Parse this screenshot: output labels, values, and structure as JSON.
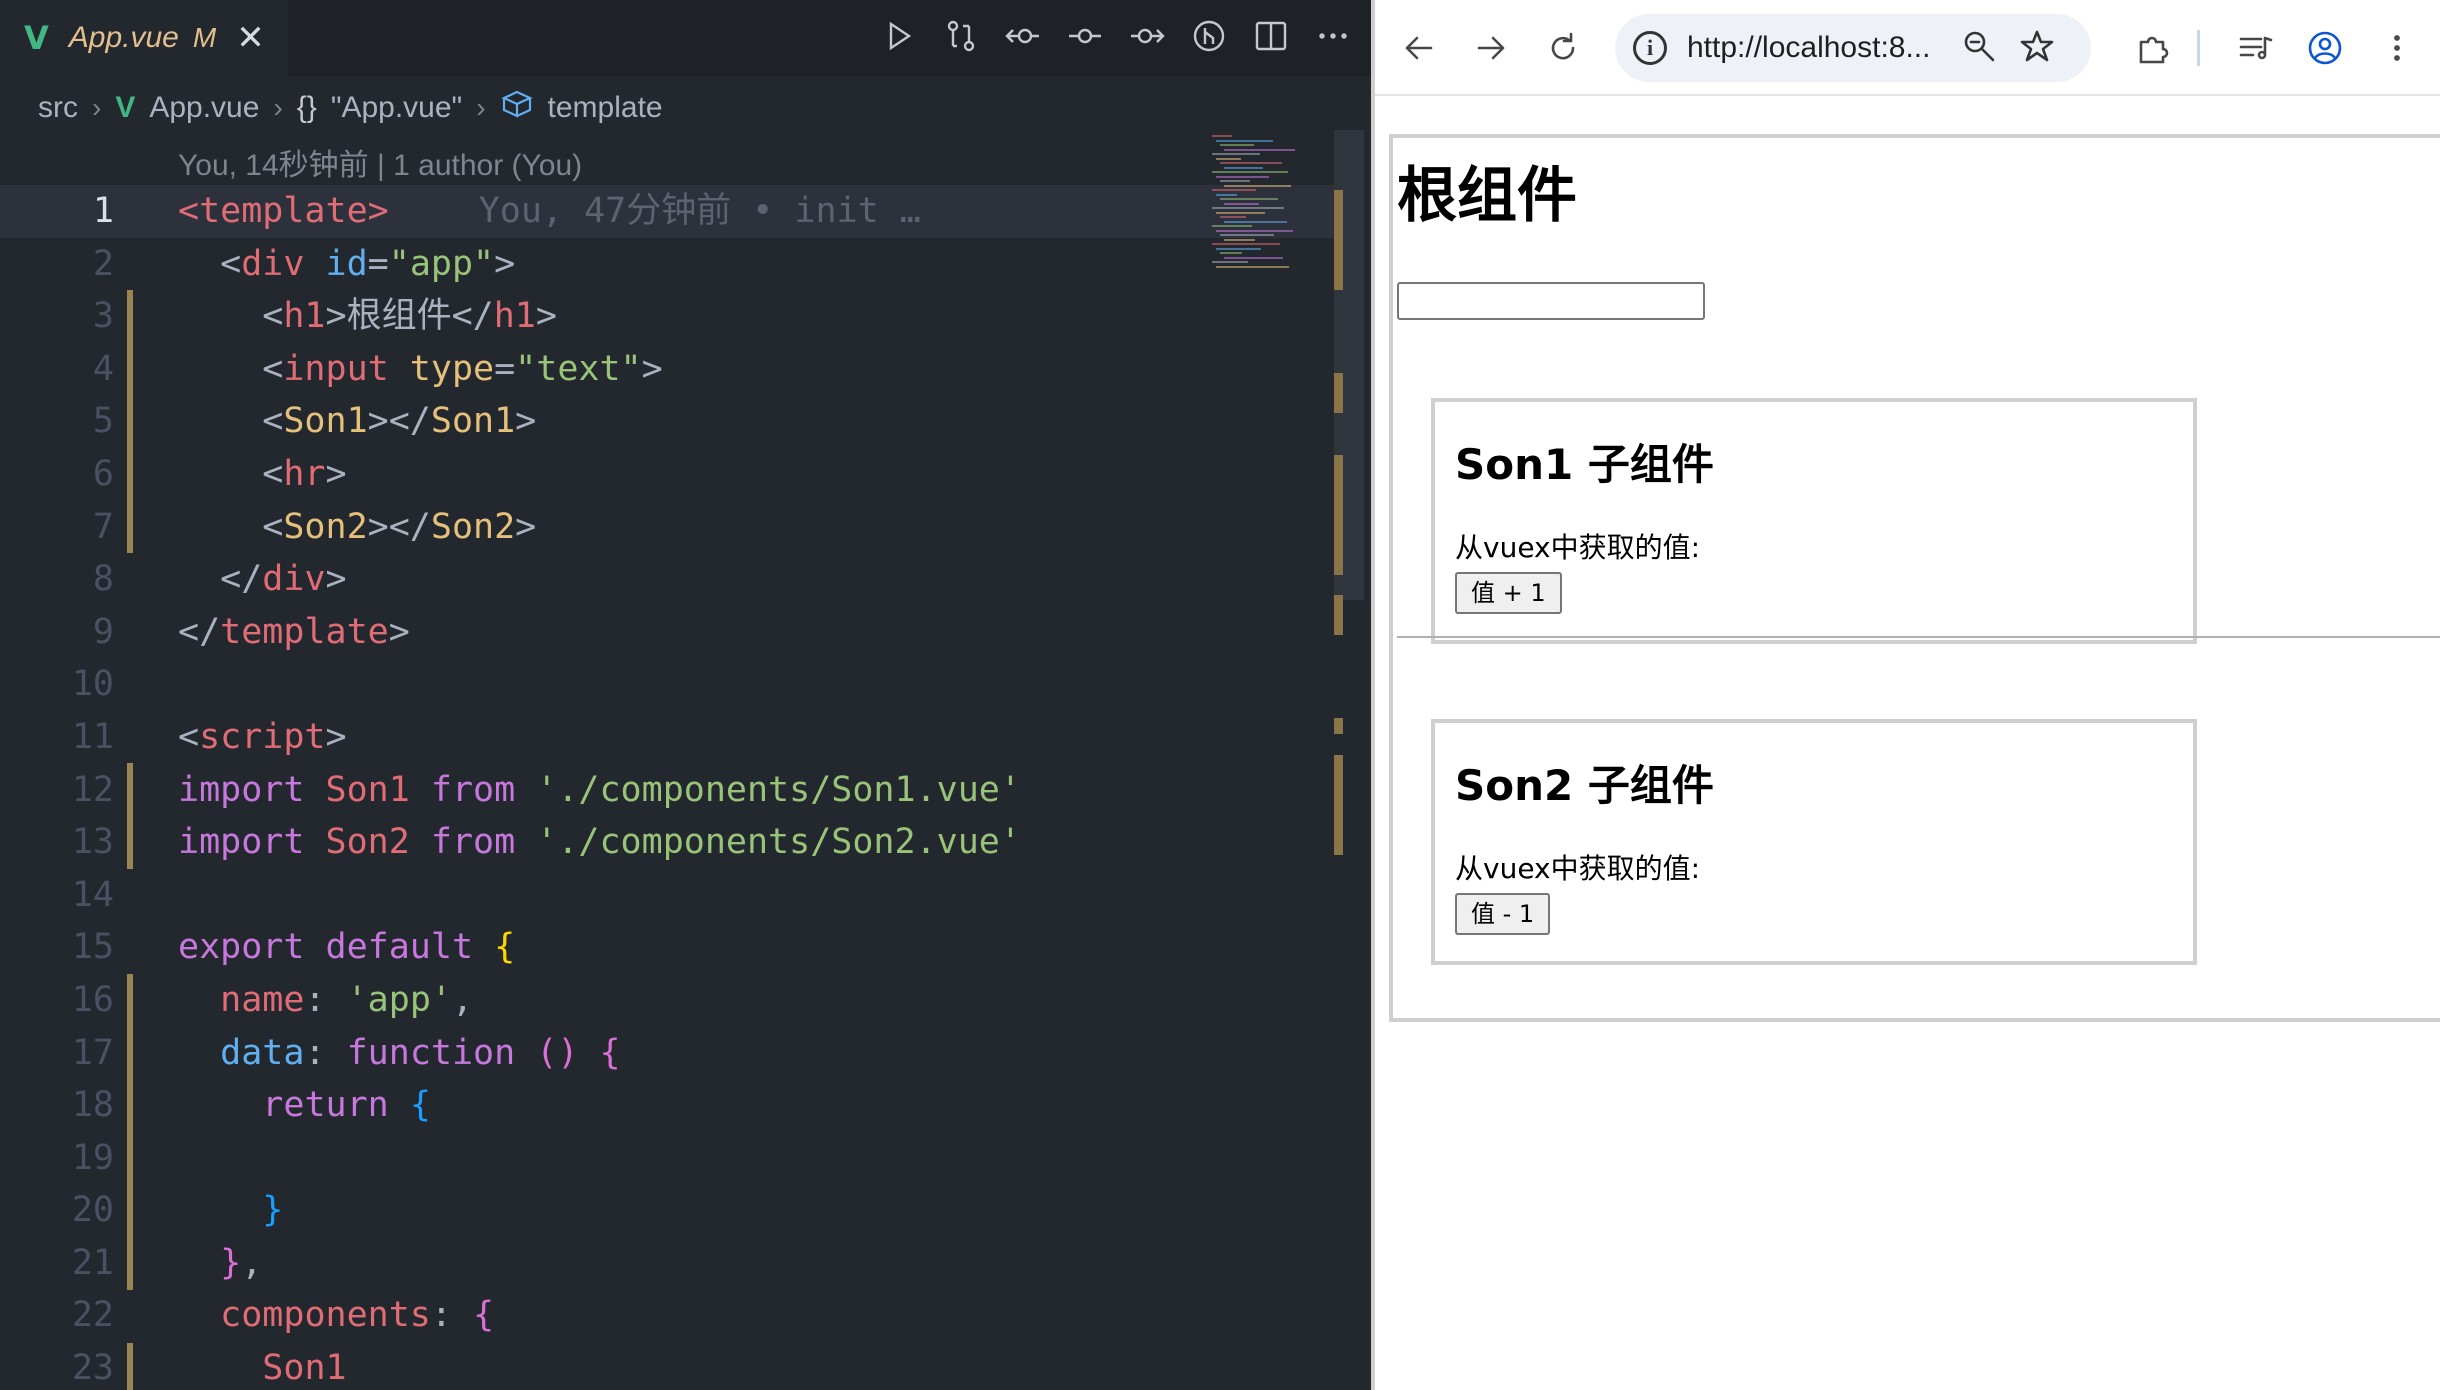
{
  "editor": {
    "tab": {
      "filename": "App.vue",
      "status": "M"
    },
    "breadcrumb": {
      "folder": "src",
      "file": "App.vue",
      "object": "\"App.vue\"",
      "symbol": "template"
    },
    "codelens": "You, 14秒钟前 | 1 author (You)",
    "blame": "You, 47分钟前 • init …",
    "colors": {
      "background": "#23272e",
      "tabbar": "#1e2227",
      "accent_vue": "#41b883",
      "modified": "#e2c08d"
    },
    "lines": [
      {
        "n": "1",
        "tokens": [
          [
            "tg",
            "<template>"
          ]
        ]
      },
      {
        "n": "2",
        "tokens": [
          [
            "pu",
            "  <"
          ],
          [
            "tg",
            "div"
          ],
          [
            "pu",
            " "
          ],
          [
            "at",
            "id"
          ],
          [
            "pu",
            "="
          ],
          [
            "st",
            "\"app\""
          ],
          [
            "pu",
            ">"
          ]
        ]
      },
      {
        "n": "3",
        "tokens": [
          [
            "pu",
            "    <"
          ],
          [
            "tg",
            "h1"
          ],
          [
            "pu",
            ">根组件</"
          ],
          [
            "tg",
            "h1"
          ],
          [
            "pu",
            ">"
          ]
        ]
      },
      {
        "n": "4",
        "tokens": [
          [
            "pu",
            "    <"
          ],
          [
            "tg",
            "input"
          ],
          [
            "pu",
            " "
          ],
          [
            "cl",
            "type"
          ],
          [
            "pu",
            "="
          ],
          [
            "st",
            "\"text\""
          ],
          [
            "pu",
            ">"
          ]
        ]
      },
      {
        "n": "5",
        "tokens": [
          [
            "pu",
            "    <"
          ],
          [
            "cl",
            "Son1"
          ],
          [
            "pu",
            "></"
          ],
          [
            "cl",
            "Son1"
          ],
          [
            "pu",
            ">"
          ]
        ]
      },
      {
        "n": "6",
        "tokens": [
          [
            "pu",
            "    <"
          ],
          [
            "tg",
            "hr"
          ],
          [
            "pu",
            ">"
          ]
        ]
      },
      {
        "n": "7",
        "tokens": [
          [
            "pu",
            "    <"
          ],
          [
            "cl",
            "Son2"
          ],
          [
            "pu",
            "></"
          ],
          [
            "cl",
            "Son2"
          ],
          [
            "pu",
            ">"
          ]
        ]
      },
      {
        "n": "8",
        "tokens": [
          [
            "pu",
            "  </"
          ],
          [
            "tg",
            "div"
          ],
          [
            "pu",
            ">"
          ]
        ]
      },
      {
        "n": "9",
        "tokens": [
          [
            "pu",
            "</"
          ],
          [
            "tg",
            "template"
          ],
          [
            "pu",
            ">"
          ]
        ]
      },
      {
        "n": "10",
        "tokens": []
      },
      {
        "n": "11",
        "tokens": [
          [
            "pu",
            "<"
          ],
          [
            "tg",
            "script"
          ],
          [
            "pu",
            ">"
          ]
        ]
      },
      {
        "n": "12",
        "tokens": [
          [
            "kw",
            "import"
          ],
          [
            "pu",
            " "
          ],
          [
            "pr",
            "Son1"
          ],
          [
            "pu",
            " "
          ],
          [
            "kw",
            "from"
          ],
          [
            "pu",
            " "
          ],
          [
            "st",
            "'./components/Son1.vue'"
          ]
        ]
      },
      {
        "n": "13",
        "tokens": [
          [
            "kw",
            "import"
          ],
          [
            "pu",
            " "
          ],
          [
            "pr",
            "Son2"
          ],
          [
            "pu",
            " "
          ],
          [
            "kw",
            "from"
          ],
          [
            "pu",
            " "
          ],
          [
            "st",
            "'./components/Son2.vue'"
          ]
        ]
      },
      {
        "n": "14",
        "tokens": []
      },
      {
        "n": "15",
        "tokens": [
          [
            "kw",
            "export"
          ],
          [
            "pu",
            " "
          ],
          [
            "kw",
            "default"
          ],
          [
            "pu",
            " "
          ],
          [
            "br",
            "{"
          ]
        ]
      },
      {
        "n": "16",
        "tokens": [
          [
            "pu",
            "  "
          ],
          [
            "pr",
            "name"
          ],
          [
            "pu",
            ": "
          ],
          [
            "st",
            "'app'"
          ],
          [
            "pu",
            ","
          ]
        ]
      },
      {
        "n": "17",
        "tokens": [
          [
            "pu",
            "  "
          ],
          [
            "at",
            "data"
          ],
          [
            "pu",
            ": "
          ],
          [
            "kw",
            "function"
          ],
          [
            "pu",
            " "
          ],
          [
            "br2",
            "()"
          ],
          [
            "pu",
            " "
          ],
          [
            "br2",
            "{"
          ]
        ]
      },
      {
        "n": "18",
        "tokens": [
          [
            "pu",
            "    "
          ],
          [
            "kw",
            "return"
          ],
          [
            "pu",
            " "
          ],
          [
            "br3",
            "{"
          ]
        ]
      },
      {
        "n": "19",
        "tokens": []
      },
      {
        "n": "20",
        "tokens": [
          [
            "pu",
            "    "
          ],
          [
            "br3",
            "}"
          ]
        ]
      },
      {
        "n": "21",
        "tokens": [
          [
            "pu",
            "  "
          ],
          [
            "br2",
            "}"
          ],
          [
            "pu",
            ","
          ]
        ]
      },
      {
        "n": "22",
        "tokens": [
          [
            "pu",
            "  "
          ],
          [
            "pr",
            "components"
          ],
          [
            "pu",
            ": "
          ],
          [
            "br2",
            "{"
          ]
        ]
      },
      {
        "n": "23",
        "tokens": [
          [
            "pu",
            "    "
          ],
          [
            "pr",
            "Son1"
          ]
        ]
      }
    ]
  },
  "browser": {
    "url": "http://localhost:8...",
    "page": {
      "title": "根组件",
      "input_value": "",
      "son1": {
        "title": "Son1 子组件",
        "text": "从vuex中获取的值:",
        "button": "值 + 1"
      },
      "son2": {
        "title": "Son2 子组件",
        "text": "从vuex中获取的值:",
        "button": "值 - 1"
      }
    }
  }
}
